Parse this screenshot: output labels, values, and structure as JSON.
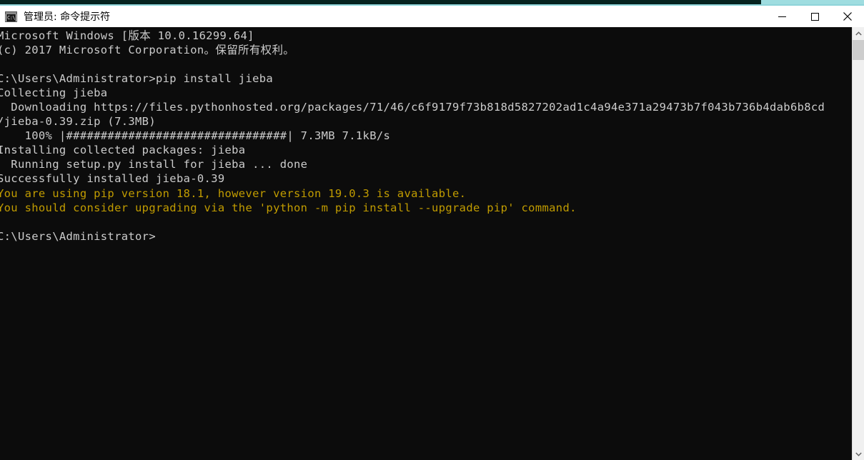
{
  "window": {
    "title": "管理员: 命令提示符",
    "icon_name": "console-window-icon",
    "icon_glyph": "C:\\",
    "accent_dark": "#05231f",
    "accent_light": "#8ed4da",
    "minimize_label": "最小化",
    "maximize_label": "最大化",
    "close_label": "关闭"
  },
  "console": {
    "background": "#0c0c0c",
    "foreground": "#cccccc",
    "warning_color": "#c19c00",
    "lines": [
      {
        "text": "Microsoft Windows [版本 10.0.16299.64]",
        "style": "normal"
      },
      {
        "text": "(c) 2017 Microsoft Corporation。保留所有权利。",
        "style": "normal"
      },
      {
        "text": "",
        "style": "normal"
      },
      {
        "text": "C:\\Users\\Administrator>pip install jieba",
        "style": "normal"
      },
      {
        "text": "Collecting jieba",
        "style": "normal"
      },
      {
        "text": "  Downloading https://files.pythonhosted.org/packages/71/46/c6f9179f73b818d5827202ad1c4a94e371a29473b7f043b736b4dab6b8cd",
        "style": "normal"
      },
      {
        "text": "/jieba-0.39.zip (7.3MB)",
        "style": "normal"
      },
      {
        "text": "    100% |################################| 7.3MB 7.1kB/s",
        "style": "bar"
      },
      {
        "text": "Installing collected packages: jieba",
        "style": "normal"
      },
      {
        "text": "  Running setup.py install for jieba ... done",
        "style": "normal"
      },
      {
        "text": "Successfully installed jieba-0.39",
        "style": "normal"
      },
      {
        "text": "You are using pip version 18.1, however version 19.0.3 is available.",
        "style": "warn"
      },
      {
        "text": "You should consider upgrading via the 'python -m pip install --upgrade pip' command.",
        "style": "warn"
      },
      {
        "text": "",
        "style": "normal"
      },
      {
        "text": "C:\\Users\\Administrator>",
        "style": "normal"
      }
    ],
    "command_entered": "pip install jieba",
    "prompt": "C:\\Users\\Administrator>",
    "package": "jieba",
    "installed_version": "jieba-0.39",
    "download_size": "7.3MB",
    "download_speed": "7.1kB/s",
    "download_percent": "100%",
    "pip_current_version": "18.1",
    "pip_available_version": "19.0.3"
  },
  "scrollbar": {
    "up_arrow": "scroll-up",
    "down_arrow": "scroll-down",
    "thumb": "scroll-thumb"
  }
}
